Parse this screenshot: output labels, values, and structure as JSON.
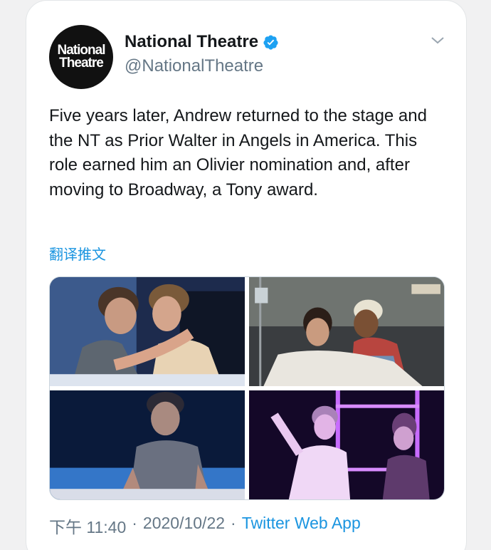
{
  "account": {
    "name": "National Theatre",
    "handle": "@NationalTheatre",
    "avatar_line1": "National",
    "avatar_line2": "Theatre",
    "verified_icon": "verified-badge-icon"
  },
  "tweet": {
    "text": "Five years later, Andrew returned to the stage and the NT as Prior Walter in Angels in America. This role earned him an Olivier nomination and, after moving to Broadway, a Tony award.",
    "translate_label": "翻译推文",
    "time": "下午 11:40",
    "date": "2020/10/22",
    "separator": "·",
    "source": "Twitter Web App"
  },
  "colors": {
    "link": "#1b95e0",
    "muted": "#657786",
    "verified": "#1da1f2"
  }
}
